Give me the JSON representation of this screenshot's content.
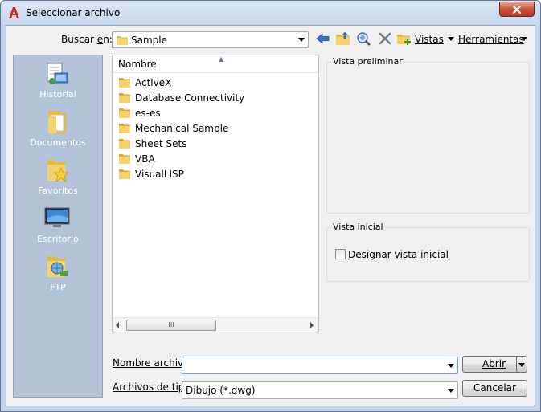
{
  "window": {
    "title": "Seleccionar archivo"
  },
  "toolbar": {
    "lookin_label_pre": "Buscar ",
    "lookin_label_ul": "e",
    "lookin_label_post": "n:",
    "lookin_value": "Sample",
    "views_label": "Vistas",
    "tools_label": "Herramientas"
  },
  "places": [
    {
      "label": "Historial",
      "icon": "history-icon"
    },
    {
      "label": "Documentos",
      "icon": "documents-folder-icon"
    },
    {
      "label": "Favoritos",
      "icon": "favorites-folder-icon"
    },
    {
      "label": "Escritorio",
      "icon": "desktop-icon"
    },
    {
      "label": "FTP",
      "icon": "ftp-icon"
    }
  ],
  "file_list": {
    "column_header": "Nombre",
    "items": [
      "ActiveX",
      "Database Connectivity",
      "es-es",
      "Mechanical Sample",
      "Sheet Sets",
      "VBA",
      "VisualLISP"
    ],
    "scroll_thumb_grip": "III"
  },
  "preview": {
    "title": "Vista preliminar"
  },
  "initial_view": {
    "title": "Vista inicial",
    "checkbox_label": "Designar vista inicial",
    "checked": false
  },
  "bottom": {
    "filename_label": "Nombre archivo:",
    "filename_value": "",
    "filetype_label": "Archivos de tipo:",
    "filetype_value": "Dibujo (*.dwg)",
    "open_label": "Abrir",
    "cancel_label": "Cancelar"
  },
  "colors": {
    "title_bar": "#c6d8ee",
    "close_button": "#c9503c",
    "places_bar": "#b4c4d8",
    "folder": "#e8b93a",
    "dialog_bg": "#f0f0f0"
  }
}
